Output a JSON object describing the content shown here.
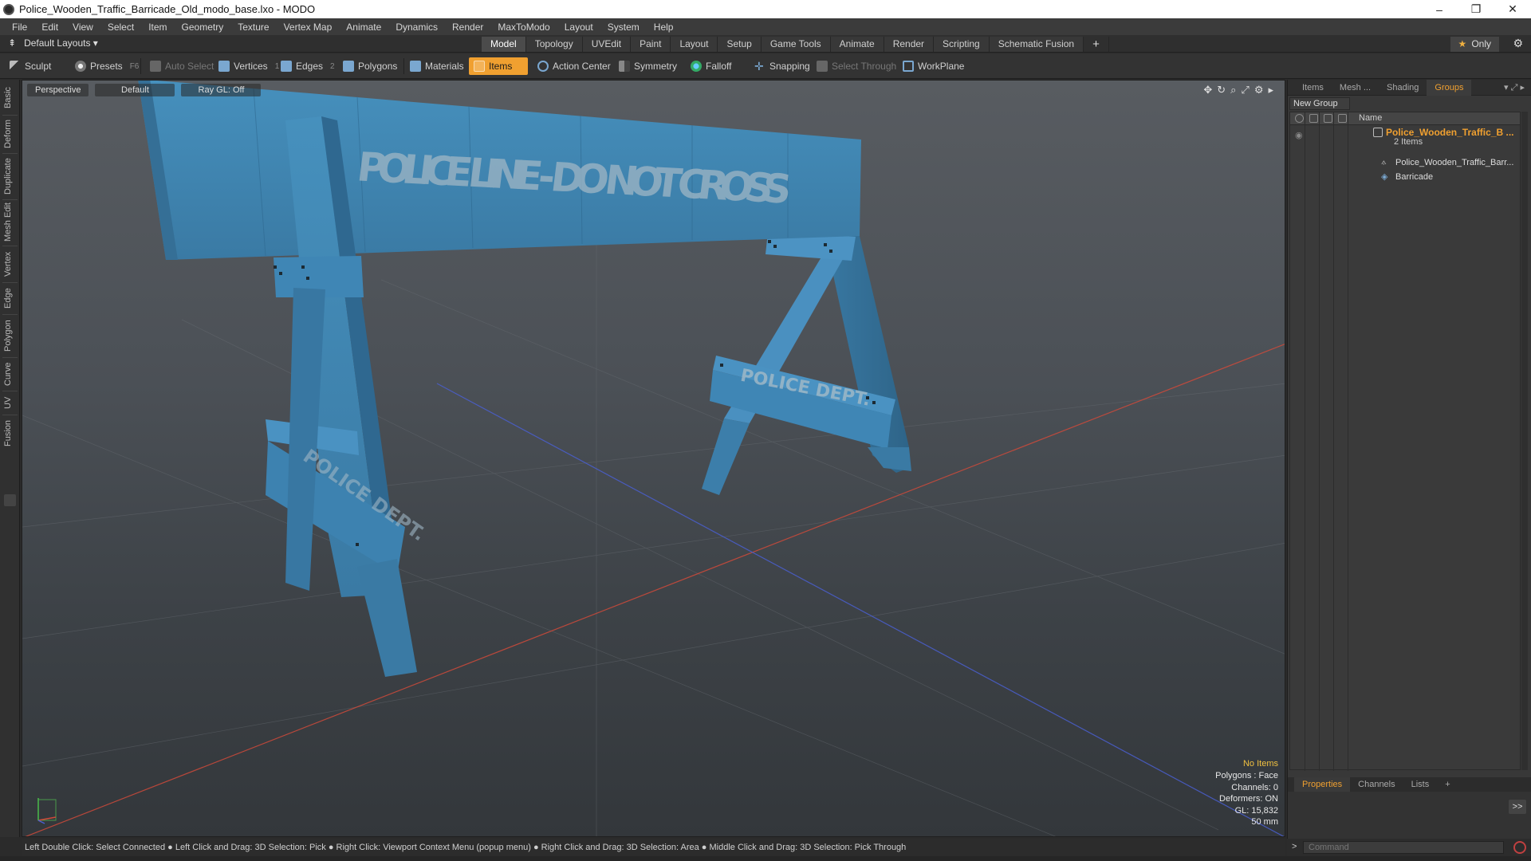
{
  "window": {
    "title": "Police_Wooden_Traffic_Barricade_Old_modo_base.lxo - MODO",
    "controls": [
      "–",
      "❐",
      "✕"
    ]
  },
  "menu": [
    "File",
    "Edit",
    "View",
    "Select",
    "Item",
    "Geometry",
    "Texture",
    "Vertex Map",
    "Animate",
    "Dynamics",
    "Render",
    "MaxToModo",
    "Layout",
    "System",
    "Help"
  ],
  "layout_bar": {
    "layouts_label": "Default Layouts ▾",
    "tabs": [
      "Model",
      "Topology",
      "UVEdit",
      "Paint",
      "Layout",
      "Setup",
      "Game Tools",
      "Animate",
      "Render",
      "Scripting",
      "Schematic Fusion"
    ],
    "active_tab": "Model",
    "plus": "+",
    "only_label": "Only"
  },
  "toolbar": {
    "sculpt": "Sculpt",
    "presets": "Presets",
    "presets_key": "F6",
    "auto_select": "Auto Select",
    "vertices": "Vertices",
    "vertices_count": "1",
    "edges": "Edges",
    "edges_count": "2",
    "polygons": "Polygons",
    "materials": "Materials",
    "items": "Items",
    "action_center": "Action Center",
    "symmetry": "Symmetry",
    "falloff": "Falloff",
    "snapping": "Snapping",
    "select_through": "Select Through",
    "workplane": "WorkPlane"
  },
  "left_strip": [
    "Basic",
    "Deform",
    "Duplicate",
    "Mesh Edit",
    "Vertex",
    "Edge",
    "Polygon",
    "Curve",
    "UV",
    "Fusion"
  ],
  "viewport": {
    "view": "Perspective",
    "shading": "Default",
    "raygl": "Ray GL: Off",
    "sign_main": "POLICE LINE - DO NOT CROSS",
    "sign_leg": "POLICE DEPT.",
    "stats": {
      "items": "No Items",
      "polygons": "Polygons : Face",
      "channels": "Channels: 0",
      "deformers": "Deformers: ON",
      "gl": "GL: 15,832",
      "scale": "50 mm"
    }
  },
  "status_bar": "Left Double Click: Select Connected ● Left Click and Drag: 3D Selection: Pick ● Right Click: Viewport Context Menu (popup menu) ● Right Click and Drag: 3D Selection: Area ● Middle Click and Drag: 3D Selection: Pick Through",
  "right_panel": {
    "tabs": [
      "Items",
      "Mesh ...",
      "Shading",
      "Groups"
    ],
    "active_tab": "Groups",
    "new_group": "New Group",
    "column_name": "Name",
    "group_name": "Police_Wooden_Traffic_B ...",
    "group_count": "2 Items",
    "children": [
      "Police_Wooden_Traffic_Barr...",
      "Barricade"
    ]
  },
  "properties_panel": {
    "tabs": [
      "Properties",
      "Channels",
      "Lists",
      "+"
    ],
    "active_tab": "Properties",
    "expand": ">>"
  },
  "command": {
    "prompt": ">",
    "placeholder": "Command"
  },
  "colors": {
    "accent": "#f0a030",
    "barricade_blue": "#3f88b5",
    "axis_x": "#d04a3a",
    "axis_z": "#4a5fd0"
  }
}
